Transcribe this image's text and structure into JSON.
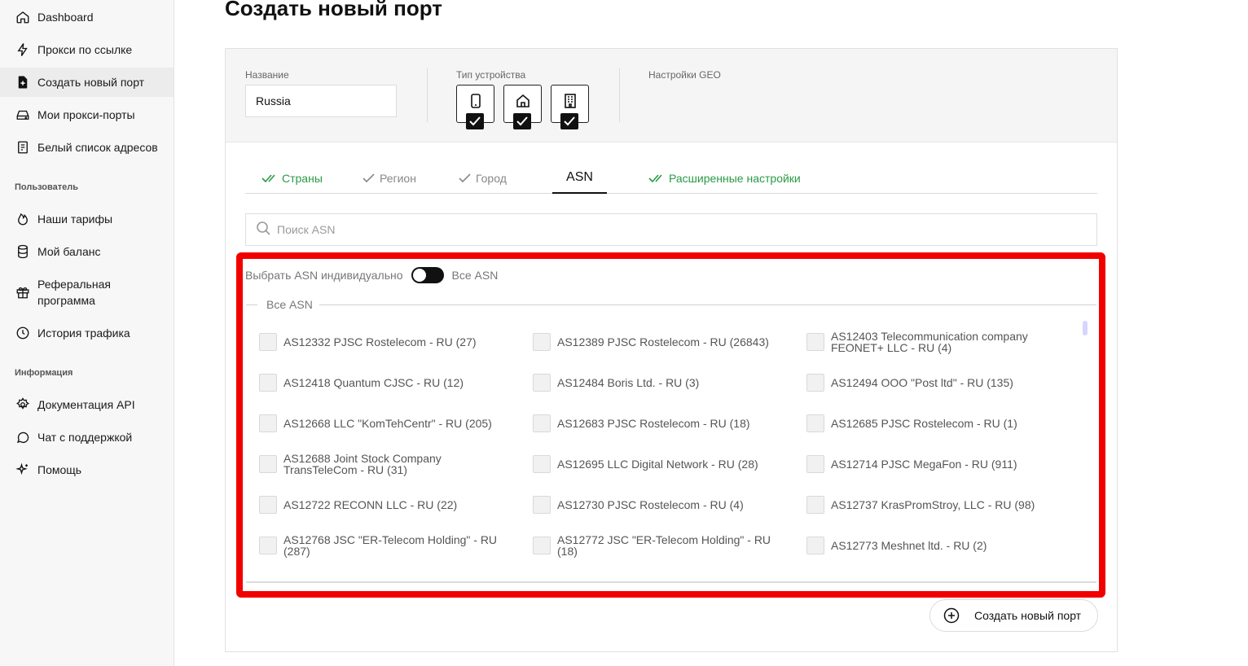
{
  "sidebar": {
    "items_top": [
      {
        "label": "Dashboard",
        "icon": "home-icon"
      },
      {
        "label": "Прокси по ссылке",
        "icon": "lightning-icon"
      },
      {
        "label": "Создать новый порт",
        "icon": "file-plus-icon",
        "active": true
      },
      {
        "label": "Мои прокси-порты",
        "icon": "hard-drive-icon"
      },
      {
        "label": "Белый список адресов",
        "icon": "document-icon"
      }
    ],
    "section_user": "Пользователь",
    "items_user": [
      {
        "label": "Наши тарифы",
        "icon": "fire-icon"
      },
      {
        "label": "Мой баланс",
        "icon": "database-icon"
      },
      {
        "label": "Реферальная программа",
        "icon": "gift-icon"
      },
      {
        "label": "История трафика",
        "icon": "clock-icon"
      }
    ],
    "section_info": "Информация",
    "items_info": [
      {
        "label": "Документация API",
        "icon": "gear-icon"
      },
      {
        "label": "Чат с поддержкой",
        "icon": "chat-icon"
      },
      {
        "label": "Помощь",
        "icon": "sparkle-icon"
      }
    ]
  },
  "page": {
    "title": "Создать новый порт"
  },
  "form": {
    "name_label": "Название",
    "name_value": "Russia",
    "device_label": "Тип устройства",
    "devices": [
      {
        "icon": "mobile-icon",
        "checked": true
      },
      {
        "icon": "house-icon",
        "checked": true
      },
      {
        "icon": "building-icon",
        "checked": true
      }
    ],
    "geo_label": "Настройки GEO"
  },
  "tabs": [
    {
      "label": "Страны",
      "state": "done"
    },
    {
      "label": "Регион",
      "state": "visited"
    },
    {
      "label": "Город",
      "state": "visited"
    },
    {
      "label": "ASN",
      "state": "active"
    },
    {
      "label": "Расширенные настройки",
      "state": "done"
    }
  ],
  "search": {
    "placeholder": "Поиск ASN"
  },
  "asn": {
    "toggle_left": "Выбрать ASN индивидуально",
    "toggle_right": "Все ASN",
    "group_title": "Все ASN",
    "items": [
      "AS12332 PJSC Rostelecom - RU (27)",
      "AS12389 PJSC Rostelecom - RU (26843)",
      "AS12403 Telecommunication company FEONET+ LLC - RU (4)",
      "AS12418 Quantum CJSC - RU (12)",
      "AS12484 Boris Ltd. - RU (3)",
      "AS12494 OOO \"Post ltd\" - RU (135)",
      "AS12668 LLC \"KomTehCentr\" - RU (205)",
      "AS12683 PJSC Rostelecom - RU (18)",
      "AS12685 PJSC Rostelecom - RU (1)",
      "AS12688 Joint Stock Company TransTeleCom - RU (31)",
      "AS12695 LLC Digital Network - RU (28)",
      "AS12714 PJSC MegaFon - RU (911)",
      "AS12722 RECONN LLC - RU (22)",
      "AS12730 PJSC Rostelecom - RU (4)",
      "AS12737 KrasPromStroy, LLC - RU (98)",
      "AS12768 JSC \"ER-Telecom Holding\" - RU (287)",
      "AS12772 JSC \"ER-Telecom Holding\" - RU (18)",
      "AS12773 Meshnet ltd. - RU (2)"
    ]
  },
  "actions": {
    "create_label": "Создать новый порт"
  },
  "colors": {
    "highlight": "#f20000",
    "done_green": "#2a9a46"
  }
}
